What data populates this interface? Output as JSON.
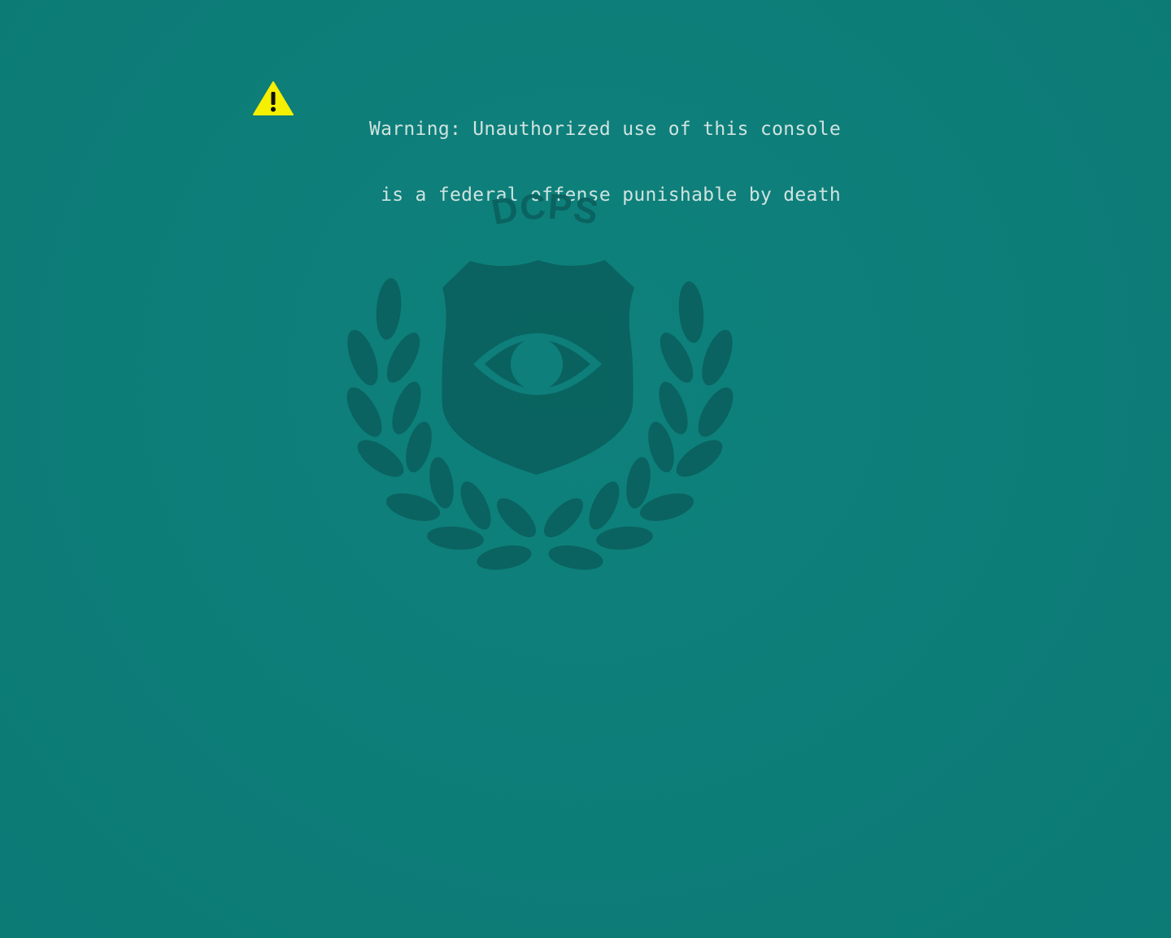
{
  "warning": {
    "icon": "warning-triangle-icon",
    "line1": "Warning: Unauthorized use of this console",
    "line2": "is a federal offense punishable by death"
  },
  "seal": {
    "text": "DCPS",
    "icon": "eye-icon"
  },
  "colors": {
    "background": "#0e7f7a",
    "warning_text": "#cfe3e0",
    "warning_icon": "#f5ef00",
    "seal": "#0a625f"
  }
}
